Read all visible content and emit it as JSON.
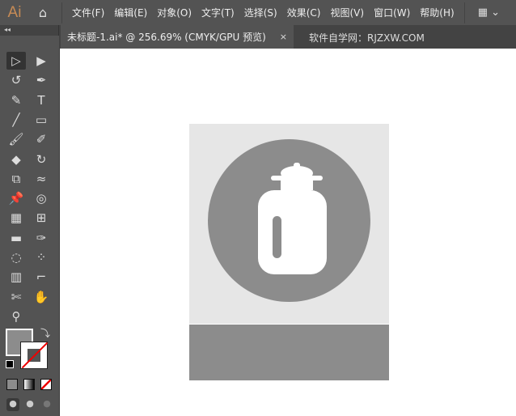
{
  "app": {
    "logo": "Ai"
  },
  "menu": [
    "文件(F)",
    "编辑(E)",
    "对象(O)",
    "文字(T)",
    "选择(S)",
    "效果(C)",
    "视图(V)",
    "窗口(W)",
    "帮助(H)"
  ],
  "tab": {
    "title": "未标题-1.ai* @ 256.69% (CMYK/GPU 预览)",
    "close": "×"
  },
  "watermark": "软件自学网：RJZXW.COM",
  "tools": [
    [
      "selection-tool",
      "▷"
    ],
    [
      "direct-selection-tool",
      "▶"
    ],
    [
      "lasso-tool",
      "↺"
    ],
    [
      "pen-tool",
      "✒"
    ],
    [
      "curvature-tool",
      "✎"
    ],
    [
      "type-tool",
      "T"
    ],
    [
      "line-tool",
      "╱"
    ],
    [
      "rectangle-tool",
      "▭"
    ],
    [
      "paintbrush-tool",
      "🖌"
    ],
    [
      "shaper-tool",
      "✐"
    ],
    [
      "eraser-tool",
      "◆"
    ],
    [
      "rotate-tool",
      "↻"
    ],
    [
      "scale-tool",
      "⧉"
    ],
    [
      "warp-tool",
      "≈"
    ],
    [
      "puppet-warp-tool",
      "📌"
    ],
    [
      "shape-builder-tool",
      "◎"
    ],
    [
      "perspective-grid-tool",
      "▦"
    ],
    [
      "mesh-tool",
      "⊞"
    ],
    [
      "gradient-tool",
      "▬"
    ],
    [
      "eyedropper-tool",
      "✑"
    ],
    [
      "blend-tool",
      "◌"
    ],
    [
      "symbol-sprayer-tool",
      "⁘"
    ],
    [
      "column-graph-tool",
      "▥"
    ],
    [
      "artboard-tool",
      "⌐"
    ],
    [
      "slice-tool",
      "✄"
    ],
    [
      "hand-tool",
      "✋"
    ],
    [
      "zoom-tool",
      "⚲"
    ],
    null
  ],
  "colors": {
    "fill": "#8c8c8c",
    "artboard": "#e6e6e6"
  }
}
